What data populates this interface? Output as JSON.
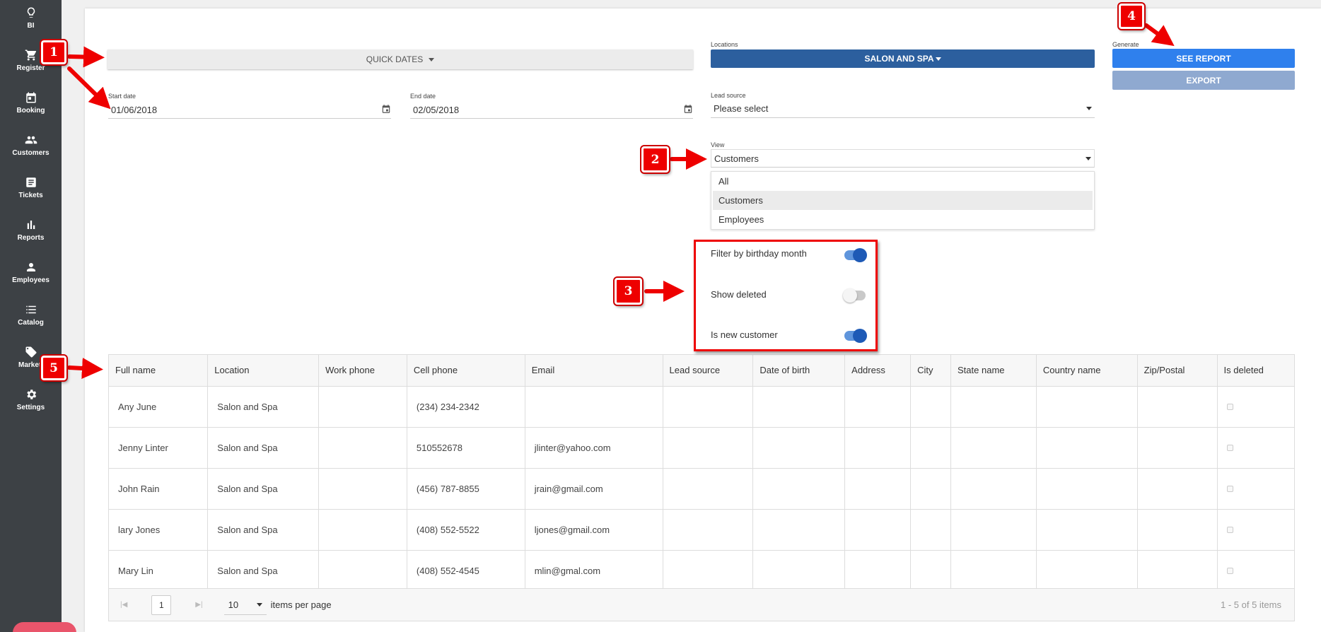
{
  "sidebar": {
    "items": [
      {
        "label": "BI",
        "icon": "lightbulb-icon"
      },
      {
        "label": "Register",
        "icon": "cart-icon"
      },
      {
        "label": "Booking",
        "icon": "calendar-icon"
      },
      {
        "label": "Customers",
        "icon": "people-icon"
      },
      {
        "label": "Tickets",
        "icon": "ticket-icon"
      },
      {
        "label": "Reports",
        "icon": "bar-chart-icon"
      },
      {
        "label": "Employees",
        "icon": "person-icon"
      },
      {
        "label": "Catalog",
        "icon": "list-icon"
      },
      {
        "label": "Marketi",
        "icon": "tag-icon"
      },
      {
        "label": "Settings",
        "icon": "gear-icon"
      }
    ]
  },
  "filters": {
    "quick_dates_label": "QUICK DATES",
    "start_date_label": "Start date",
    "start_date_value": "01/06/2018",
    "end_date_label": "End date",
    "end_date_value": "02/05/2018",
    "locations_label": "Locations",
    "locations_value": "SALON AND SPA",
    "lead_source_label": "Lead source",
    "lead_source_value": "Please select",
    "view_label": "View",
    "view_value": "Customers",
    "view_options": [
      "All",
      "Customers",
      "Employees"
    ],
    "generate_label": "Generate",
    "see_report_label": "SEE REPORT",
    "export_label": "EXPORT"
  },
  "toggles": [
    {
      "label": "Filter by birthday month",
      "on": true
    },
    {
      "label": "Show deleted",
      "on": false
    },
    {
      "label": "Is new customer",
      "on": true
    }
  ],
  "table": {
    "columns": [
      "Full name",
      "Location",
      "Work phone",
      "Cell phone",
      "Email",
      "Lead source",
      "Date of birth",
      "Address",
      "City",
      "State name",
      "Country name",
      "Zip/Postal",
      "Is deleted"
    ],
    "rows": [
      [
        "Any June",
        "Salon and Spa",
        "",
        "(234) 234-2342",
        "",
        "",
        "",
        "",
        "",
        "",
        "",
        "",
        ""
      ],
      [
        "Jenny Linter",
        "Salon and Spa",
        "",
        "510552678",
        "jlinter@yahoo.com",
        "",
        "",
        "",
        "",
        "",
        "",
        "",
        ""
      ],
      [
        "John Rain",
        "Salon and Spa",
        "",
        "(456) 787-8855",
        "jrain@gmail.com",
        "",
        "",
        "",
        "",
        "",
        "",
        "",
        ""
      ],
      [
        "lary Jones",
        "Salon and Spa",
        "",
        "(408) 552-5522",
        "ljones@gmail.com",
        "",
        "",
        "",
        "",
        "",
        "",
        "",
        ""
      ],
      [
        "Mary Lin",
        "Salon and Spa",
        "",
        "(408) 552-4545",
        "mlin@gmal.com",
        "",
        "",
        "",
        "",
        "",
        "",
        "",
        ""
      ]
    ]
  },
  "pager": {
    "page": "1",
    "page_size": "10",
    "items_per_page_label": "items per page",
    "summary": "1 - 5 of 5 items"
  },
  "annotations": {
    "badges": [
      "1",
      "2",
      "3",
      "4",
      "5"
    ],
    "color": "#e00000"
  },
  "colors": {
    "sidebar": "#3d4145",
    "locations_button": "#2c5f9e",
    "see_report_button": "#2f80ed",
    "export_button": "#8fa9d0",
    "toggle_on": "#1e5ab6"
  }
}
